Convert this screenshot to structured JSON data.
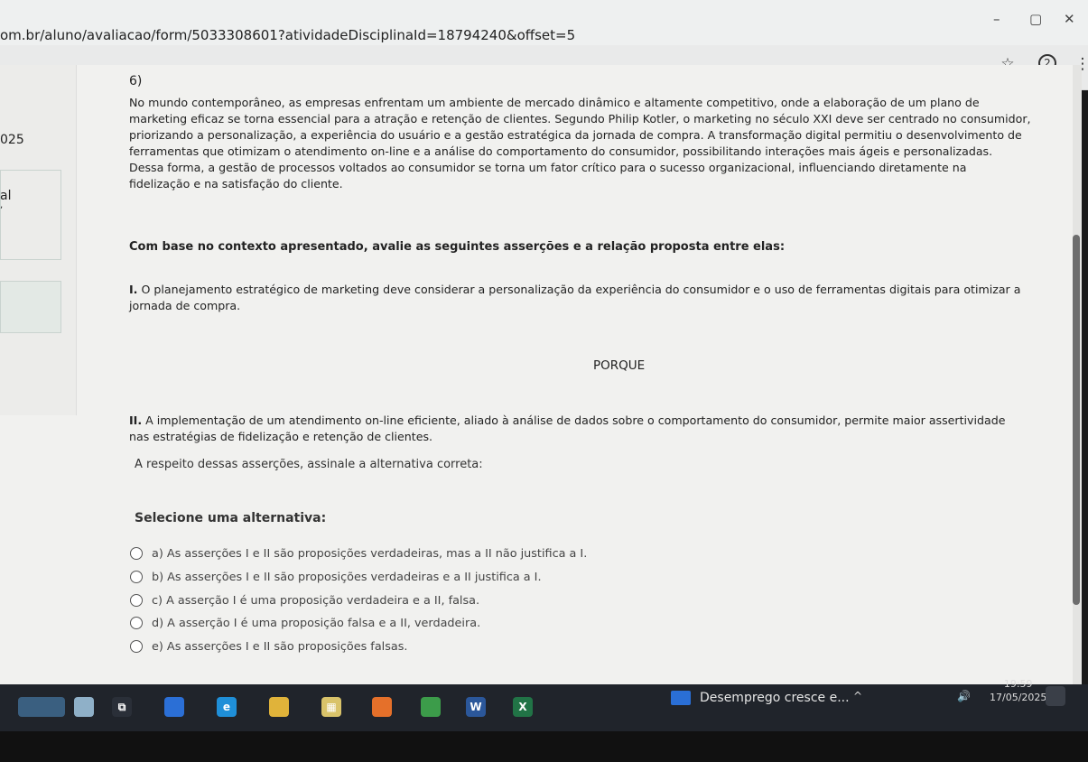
{
  "browser": {
    "url": "om.br/aluno/avaliacao/form/5033308601?atividadeDisciplinaId=18794240&offset=5",
    "minimize_glyph": "–",
    "restore_glyph": "▢",
    "close_glyph": "✕",
    "bookmark_icon": "star-icon",
    "bookmark_glyph": "☆",
    "profile_icon": "profile-icon",
    "profile_glyph": "2",
    "menu_icon": "kebab-menu-icon",
    "menu_glyph": "⋮"
  },
  "left_panel": {
    "year_fragment": "025",
    "label_fragment": "al",
    "mark_fragment": ","
  },
  "question": {
    "number": "6)",
    "context_lines": [
      "No mundo contemporâneo, as empresas enfrentam um ambiente de mercado dinâmico e altamente competitivo, onde a elaboração de um plano de",
      "marketing eficaz se torna essencial para a atração e retenção de clientes. Segundo Philip Kotler, o marketing no século XXI deve ser centrado no consumidor,",
      "priorizando a personalização, a experiência do usuário e a gestão estratégica da jornada de compra. A transformação digital permitiu o desenvolvimento de",
      "ferramentas que otimizam o atendimento on-line e a análise do comportamento do consumidor, possibilitando interações mais ágeis e personalizadas.",
      "Dessa forma, a gestão de processos voltados ao consumidor se torna um fator crítico para o sucesso organizacional, influenciando diretamente na",
      "fidelização e na satisfação do cliente."
    ],
    "prompt": "Com base no contexto apresentado, avalie as seguintes asserções e a relação proposta entre elas:",
    "assertion_1_label": "I.",
    "assertion_1_line1": "O planejamento estratégico de marketing deve considerar a personalização da experiência do consumidor e o uso de ferramentas digitais para otimizar a",
    "assertion_1_line2": "jornada de compra.",
    "connector": "PORQUE",
    "assertion_2_label": "II.",
    "assertion_2_line1": "A implementação de um atendimento on-line eficiente, aliado à análise de dados sobre o comportamento do consumidor, permite maior assertividade",
    "assertion_2_line2": "nas estratégias de fidelização e retenção de clientes.",
    "instruction": "A respeito dessas asserções, assinale a alternativa correta:",
    "select_label": "Selecione uma alternativa:",
    "options": [
      "a) As asserções I e II são proposições verdadeiras, mas a II não justifica a I.",
      "b) As asserções I e II são proposições verdadeiras e a II justifica a I.",
      "c) A asserção I é uma proposição verdadeira e a II, falsa.",
      "d) A asserção I é uma proposição falsa e a II, verdadeira.",
      "e) As asserções I e II são proposições falsas."
    ]
  },
  "taskbar": {
    "apps": [
      {
        "name": "task-view-icon",
        "color": "#2a2f38",
        "glyph": "⧉"
      },
      {
        "name": "app-icon-1",
        "color": "#2b6fd6",
        "glyph": ""
      },
      {
        "name": "edge-icon",
        "color": "#1f8fd8",
        "glyph": "e"
      },
      {
        "name": "file-explorer-icon",
        "color": "#e0b33a",
        "glyph": ""
      },
      {
        "name": "store-icon",
        "color": "#d9c36a",
        "glyph": "▦"
      },
      {
        "name": "firefox-icon",
        "color": "#e5702a",
        "glyph": ""
      },
      {
        "name": "chrome-icon",
        "color": "#3c9c4a",
        "glyph": ""
      },
      {
        "name": "word-icon",
        "color": "#2b579a",
        "glyph": "W"
      },
      {
        "name": "excel-icon",
        "color": "#217346",
        "glyph": "X"
      }
    ],
    "news": "Desemprego cresce e...",
    "tray_chevron": "^",
    "tray_speaker": "🔊",
    "time": "19:59",
    "date": "17/05/2025"
  }
}
